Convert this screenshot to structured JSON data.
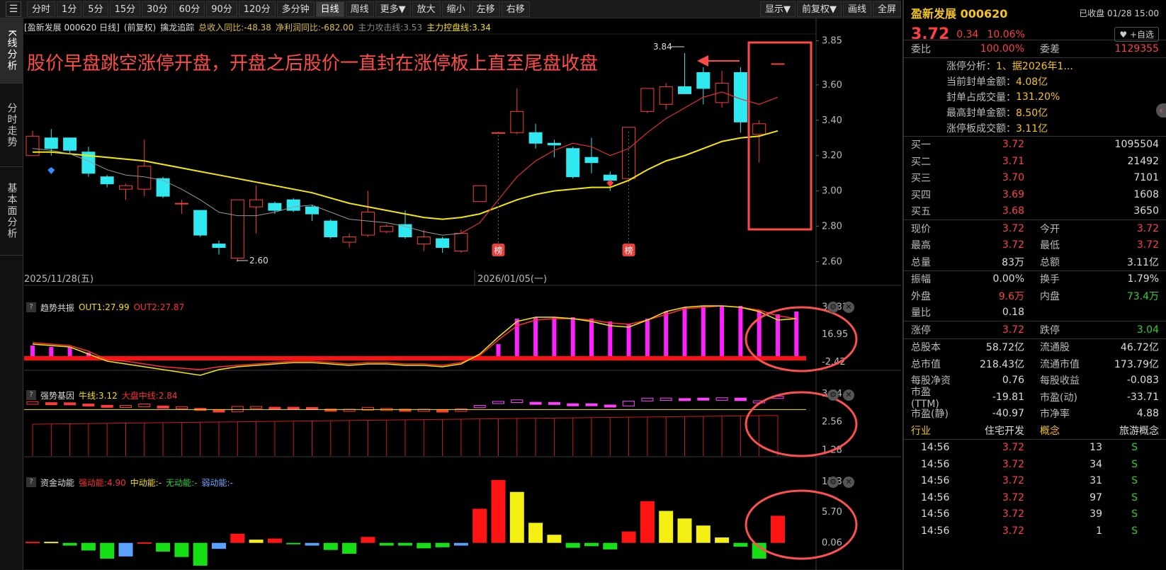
{
  "toolbar": {
    "buttons": [
      "分时",
      "1分",
      "5分",
      "15分",
      "30分",
      "60分",
      "90分",
      "120分",
      "多分钟",
      "日线",
      "周线",
      "更多▼",
      "放大",
      "缩小",
      "左移",
      "右移"
    ],
    "active": "日线",
    "right_buttons": [
      "显示▼",
      "前复权▼",
      "画线",
      "全屏"
    ]
  },
  "vtabs": [
    "K线分析",
    "分时走势",
    "基本面分析"
  ],
  "main_panel": {
    "title": "[盈新发展 000620 日线]",
    "adjust": "(前复权)",
    "indicator_name": "擒龙追踪",
    "items": [
      {
        "text": "总收入同比:-48.38",
        "color": "#e0c040"
      },
      {
        "text": "净利润同比:-682.00",
        "color": "#e0c040"
      },
      {
        "text": "主力攻击线:3.53",
        "color": "#888888"
      },
      {
        "text": "主力控盘线:3.34",
        "color": "#f5e000"
      }
    ],
    "annotation": "股价早盘跳空涨停开盘，开盘之后股价一直封在涨停板上直至尾盘收盘",
    "y_ticks": [
      "3.85",
      "3.60",
      "3.40",
      "3.20",
      "3.00",
      "2.80",
      "2.60"
    ],
    "x_labels": [
      "2025/11/28(五)",
      "2026/01/05(一)"
    ],
    "high_label": "3.84",
    "low_label": "2.60",
    "bang_label": "榜"
  },
  "ind1": {
    "name": "趋势共振",
    "items": [
      {
        "text": "OUT1:27.99",
        "color": "#f5e000"
      },
      {
        "text": "OUT2:27.87",
        "color": "#ff3030"
      }
    ],
    "y_ticks": [
      "36.32",
      "16.95",
      "-2.42"
    ]
  },
  "ind2": {
    "name": "强势基因",
    "items": [
      {
        "text": "牛线:3.12",
        "color": "#f5e000"
      },
      {
        "text": "大盘中线:2.84",
        "color": "#ff3030"
      }
    ],
    "y_ticks": [
      "3.84",
      "2.56",
      "1.28"
    ]
  },
  "ind3": {
    "name": "资金动能",
    "items": [
      {
        "text": "强动能:4.90",
        "color": "#ff3030"
      },
      {
        "text": "中动能:-",
        "color": "#f5e000"
      },
      {
        "text": "无动能:-",
        "color": "#30d030"
      },
      {
        "text": "弱动能:-",
        "color": "#6aa8ff"
      }
    ],
    "y_ticks": [
      "11.34",
      "5.70",
      "0.06"
    ]
  },
  "right": {
    "stock_name": "盈新发展  000620",
    "close_status": "已收盘 01/28 15:00",
    "price": "3.72",
    "change": "0.34",
    "change_pct": "10.06%",
    "fav_label": "+自选",
    "weibi_label": "委比",
    "weibi": "100.00%",
    "weicha_label": "委差",
    "weicha": "1129355",
    "zt_analysis": [
      {
        "label": "涨停分析：",
        "value": "1、据2026年1..."
      },
      {
        "label": "当前封单金额：",
        "value": "4.08亿"
      },
      {
        "label": "封单占成交量：",
        "value": "131.20%"
      },
      {
        "label": "最高封单金额：",
        "value": "8.50亿"
      },
      {
        "label": "涨停板成交额：",
        "value": "3.11亿"
      }
    ],
    "bids": [
      {
        "label": "买一",
        "price": "3.72",
        "vol": "1095504"
      },
      {
        "label": "买二",
        "price": "3.71",
        "vol": "21492"
      },
      {
        "label": "买三",
        "price": "3.70",
        "vol": "7101"
      },
      {
        "label": "买四",
        "price": "3.69",
        "vol": "1608"
      },
      {
        "label": "买五",
        "price": "3.68",
        "vol": "3650"
      }
    ],
    "quote": [
      {
        "l1": "现价",
        "v1": "3.72",
        "c1": "red",
        "l2": "今开",
        "v2": "3.72",
        "c2": "red"
      },
      {
        "l1": "最高",
        "v1": "3.72",
        "c1": "red",
        "l2": "最低",
        "v2": "3.72",
        "c2": "red"
      },
      {
        "l1": "总量",
        "v1": "83万",
        "c1": "white",
        "l2": "总额",
        "v2": "3.11亿",
        "c2": "white"
      }
    ],
    "quote2": [
      {
        "l1": "振幅",
        "v1": "0.00%",
        "c1": "white",
        "l2": "换手",
        "v2": "1.79%",
        "c2": "white"
      },
      {
        "l1": "外盘",
        "v1": "9.6万",
        "c1": "red",
        "l2": "内盘",
        "v2": "73.4万",
        "c2": "green"
      },
      {
        "l1": "量比",
        "v1": "0.18",
        "c1": "white",
        "l2": "",
        "v2": "",
        "c2": "white"
      }
    ],
    "limits": {
      "l1": "涨停",
      "v1": "3.72",
      "l2": "跌停",
      "v2": "3.04"
    },
    "fundamentals": [
      {
        "l1": "总股本",
        "v1": "58.72亿",
        "l2": "流通股",
        "v2": "46.72亿"
      },
      {
        "l1": "总市值",
        "v1": "218.43亿",
        "l2": "流通市值",
        "v2": "173.79亿"
      },
      {
        "l1": "每股净资",
        "v1": "0.76",
        "l2": "每股收益",
        "v2": "-0.083"
      },
      {
        "l1": "市盈(TTM)",
        "v1": "-19.81",
        "l2": "市盈(动)",
        "v2": "-33.71"
      },
      {
        "l1": "市盈(静)",
        "v1": "-40.97",
        "l2": "市净率",
        "v2": "4.88"
      }
    ],
    "industry_label": "行业",
    "industry": "住宅开发",
    "concept_label": "概念",
    "concept": "旅游概念",
    "ticks": [
      {
        "time": "14:56",
        "price": "3.72",
        "vol": "13",
        "side": "S"
      },
      {
        "time": "14:56",
        "price": "3.72",
        "vol": "34",
        "side": "S"
      },
      {
        "time": "14:56",
        "price": "3.72",
        "vol": "31",
        "side": "S"
      },
      {
        "time": "14:56",
        "price": "3.72",
        "vol": "97",
        "side": "S"
      },
      {
        "time": "14:56",
        "price": "3.72",
        "vol": "39",
        "side": "S"
      },
      {
        "time": "14:56",
        "price": "3.72",
        "vol": "1",
        "side": "S"
      }
    ]
  },
  "chart_data": {
    "type": "candlestick",
    "candles": [
      {
        "o": 3.2,
        "c": 3.31,
        "h": 3.34,
        "l": 3.2
      },
      {
        "o": 3.3,
        "c": 3.24,
        "h": 3.35,
        "l": 3.2
      },
      {
        "o": 3.3,
        "c": 3.23,
        "h": 3.3,
        "l": 3.21
      },
      {
        "o": 3.22,
        "c": 3.1,
        "h": 3.25,
        "l": 3.08
      },
      {
        "o": 3.08,
        "c": 3.04,
        "h": 3.09,
        "l": 3.02
      },
      {
        "o": 3.01,
        "c": 3.03,
        "h": 3.04,
        "l": 2.95
      },
      {
        "o": 3.01,
        "c": 3.14,
        "h": 3.29,
        "l": 2.97
      },
      {
        "o": 3.07,
        "c": 2.97,
        "h": 3.08,
        "l": 2.96
      },
      {
        "o": 2.93,
        "c": 2.93,
        "h": 2.95,
        "l": 2.87
      },
      {
        "o": 2.89,
        "c": 2.75,
        "h": 2.89,
        "l": 2.74
      },
      {
        "o": 2.7,
        "c": 2.68,
        "h": 2.72,
        "l": 2.64
      },
      {
        "o": 2.62,
        "c": 2.95,
        "h": 2.95,
        "l": 2.6
      },
      {
        "o": 2.91,
        "c": 2.95,
        "h": 3.03,
        "l": 2.76
      },
      {
        "o": 2.93,
        "c": 2.89,
        "h": 2.94,
        "l": 2.87
      },
      {
        "o": 2.95,
        "c": 2.89,
        "h": 2.96,
        "l": 2.88
      },
      {
        "o": 2.91,
        "c": 2.87,
        "h": 2.92,
        "l": 2.83
      },
      {
        "o": 2.83,
        "c": 2.74,
        "h": 2.84,
        "l": 2.73
      },
      {
        "o": 2.71,
        "c": 2.74,
        "h": 2.76,
        "l": 2.68
      },
      {
        "o": 2.75,
        "c": 2.88,
        "h": 3.0,
        "l": 2.74
      },
      {
        "o": 2.77,
        "c": 2.8,
        "h": 2.81,
        "l": 2.76
      },
      {
        "o": 2.81,
        "c": 2.74,
        "h": 2.89,
        "l": 2.73
      },
      {
        "o": 2.7,
        "c": 2.74,
        "h": 2.78,
        "l": 2.66
      },
      {
        "o": 2.73,
        "c": 2.68,
        "h": 2.74,
        "l": 2.65
      },
      {
        "o": 2.66,
        "c": 2.76,
        "h": 2.78,
        "l": 2.65
      },
      {
        "o": 2.94,
        "c": 3.03,
        "h": 3.03,
        "l": 2.94
      },
      {
        "o": 3.33,
        "c": 3.33,
        "h": 3.33,
        "l": 3.33
      },
      {
        "o": 3.33,
        "c": 3.45,
        "h": 3.58,
        "l": 3.32
      },
      {
        "o": 3.33,
        "c": 3.27,
        "h": 3.38,
        "l": 3.24
      },
      {
        "o": 3.27,
        "c": 3.26,
        "h": 3.29,
        "l": 3.19
      },
      {
        "o": 3.24,
        "c": 3.08,
        "h": 3.25,
        "l": 3.07
      },
      {
        "o": 3.19,
        "c": 3.16,
        "h": 3.3,
        "l": 3.1
      },
      {
        "o": 3.09,
        "c": 3.06,
        "h": 3.11,
        "l": 3.0
      },
      {
        "o": 3.07,
        "c": 3.36,
        "h": 3.36,
        "l": 3.07
      },
      {
        "o": 3.45,
        "c": 3.58,
        "h": 3.58,
        "l": 3.44
      },
      {
        "o": 3.49,
        "c": 3.59,
        "h": 3.61,
        "l": 3.46
      },
      {
        "o": 3.59,
        "c": 3.55,
        "h": 3.78,
        "l": 3.55
      },
      {
        "o": 3.67,
        "c": 3.58,
        "h": 3.7,
        "l": 3.49
      },
      {
        "o": 3.5,
        "c": 3.61,
        "h": 3.68,
        "l": 3.47
      },
      {
        "o": 3.67,
        "c": 3.39,
        "h": 3.7,
        "l": 3.33
      },
      {
        "o": 3.32,
        "c": 3.38,
        "h": 3.4,
        "l": 3.16
      },
      {
        "o": 3.72,
        "c": 3.72,
        "h": 3.72,
        "l": 3.72
      }
    ],
    "ma_slow": [
      3.22,
      3.22,
      3.21,
      3.2,
      3.19,
      3.18,
      3.17,
      3.15,
      3.13,
      3.11,
      3.09,
      3.07,
      3.05,
      3.03,
      3.01,
      2.99,
      2.96,
      2.93,
      2.91,
      2.89,
      2.87,
      2.85,
      2.84,
      2.85,
      2.87,
      2.91,
      2.95,
      2.98,
      3.0,
      3.01,
      3.02,
      3.02,
      3.06,
      3.12,
      3.17,
      3.2,
      3.24,
      3.28,
      3.3,
      3.31,
      3.34
    ],
    "ma_fast": [
      3.24,
      3.23,
      3.21,
      3.17,
      3.12,
      3.09,
      3.08,
      3.06,
      3.01,
      2.95,
      2.88,
      2.86,
      2.86,
      2.88,
      2.91,
      2.92,
      2.88,
      2.84,
      2.83,
      2.82,
      2.8,
      2.77,
      2.75,
      2.76,
      2.82,
      2.95,
      3.08,
      3.17,
      3.23,
      3.27,
      3.25,
      3.2,
      3.24,
      3.33,
      3.41,
      3.47,
      3.53,
      3.56,
      3.52,
      3.49,
      3.53
    ],
    "ylim": [
      2.55,
      3.88
    ],
    "ind1": {
      "bars": [
        9,
        8,
        8,
        4,
        0,
        0,
        0,
        0,
        0,
        0,
        0,
        0,
        0,
        0,
        0,
        0,
        0,
        0,
        0,
        0,
        0,
        0,
        0,
        0,
        0,
        10,
        28,
        29,
        29,
        29,
        28,
        26,
        24,
        28,
        33,
        36,
        37,
        37,
        37,
        34,
        31,
        33
      ],
      "out1": [
        10,
        9,
        8,
        3,
        -2,
        -4,
        -6,
        -8,
        -10,
        -12,
        -8,
        -6,
        -5,
        -4,
        -3,
        -3,
        -4,
        -5,
        -4,
        -4,
        -5,
        -5,
        -6,
        -4,
        3,
        15,
        26,
        29,
        29,
        28,
        26,
        23,
        22,
        27,
        33,
        36,
        37,
        37,
        36,
        33,
        27,
        28
      ],
      "out2": [
        11,
        10,
        9,
        5,
        -1,
        -2,
        -4,
        -6,
        -7,
        -8,
        -6,
        -5,
        -4,
        -3,
        -2,
        -2,
        -3,
        -4,
        -3,
        -3,
        -4,
        -4,
        -5,
        -3,
        2,
        13,
        23,
        27,
        28,
        28,
        27,
        25,
        24,
        27,
        31,
        35,
        36,
        37,
        36,
        34,
        30,
        28
      ],
      "ylim": [
        -5,
        40
      ]
    },
    "ind2": {
      "ylim": [
        1.0,
        4.1
      ],
      "bull": 3.12,
      "big": 2.84
    },
    "ind3": {
      "vals": [
        0.2,
        0.2,
        -0.5,
        -1.4,
        -2.9,
        -2.5,
        0.1,
        -1.6,
        -2.6,
        -4.2,
        -1.1,
        1.7,
        0.6,
        0.8,
        -0.2,
        -0.5,
        -1.3,
        -2.0,
        1.1,
        -0.5,
        -0.5,
        -1.0,
        -0.8,
        -0.5,
        6.3,
        11.6,
        9.4,
        3.7,
        1.5,
        -0.9,
        -0.6,
        -1.2,
        2.1,
        7.7,
        5.9,
        4.5,
        3.2,
        1.0,
        -0.7,
        -2.9,
        5.0
      ],
      "types": [
        "r",
        "y",
        "g",
        "g",
        "g",
        "b",
        "r",
        "g",
        "g",
        "g",
        "b",
        "r",
        "y",
        "r",
        "g",
        "b",
        "g",
        "g",
        "r",
        "g",
        "g",
        "g",
        "g",
        "b",
        "r",
        "r",
        "y",
        "y",
        "y",
        "g",
        "g",
        "g",
        "r",
        "r",
        "y",
        "y",
        "y",
        "y",
        "g",
        "g",
        "r"
      ],
      "ylim": [
        -5,
        12.5
      ]
    }
  }
}
